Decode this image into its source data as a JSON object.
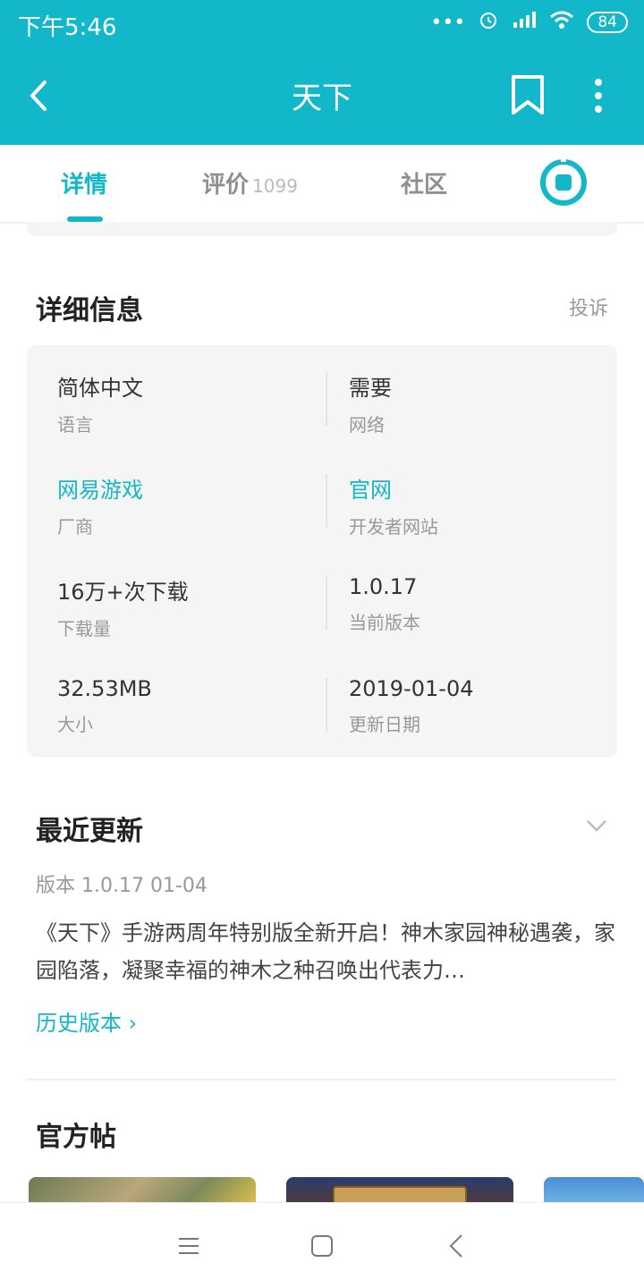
{
  "status_bar": {
    "time": "下午5:46",
    "battery": "84"
  },
  "header": {
    "title": "天下"
  },
  "tabs": [
    {
      "label": "详情"
    },
    {
      "label": "评价",
      "count": "1099"
    },
    {
      "label": "社区"
    }
  ],
  "details": {
    "title": "详细信息",
    "report": "投诉",
    "items": [
      {
        "value": "简体中文",
        "label": "语言"
      },
      {
        "value": "需要",
        "label": "网络"
      },
      {
        "value": "网易游戏",
        "label": "厂商"
      },
      {
        "value": "官网",
        "label": "开发者网站"
      },
      {
        "value": "16万+次下载",
        "label": "下载量"
      },
      {
        "value": "1.0.17",
        "label": "当前版本"
      },
      {
        "value": "32.53MB",
        "label": "大小"
      },
      {
        "value": "2019-01-04",
        "label": "更新日期"
      }
    ]
  },
  "recent_update": {
    "title": "最近更新",
    "version_line": "版本 1.0.17   01-04",
    "text": "《天下》手游两周年特别版全新开启！神木家园神秘遇袭，家园陷落，凝聚幸福的神木之种召唤出代表力…",
    "history_link": "历史版本 ›"
  },
  "official": {
    "title": "官方帖"
  },
  "colors": {
    "accent": "#12b8c9"
  }
}
